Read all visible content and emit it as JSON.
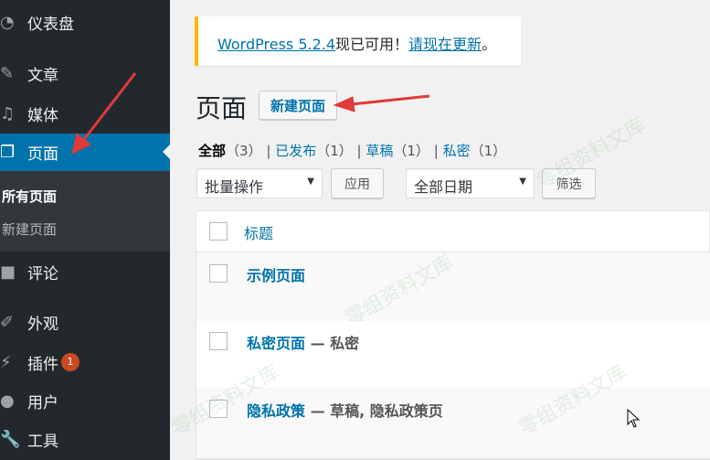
{
  "sidebar": {
    "items": [
      {
        "label": "仪表盘",
        "icon": "dashboard-icon"
      },
      {
        "label": "文章",
        "icon": "pin-icon"
      },
      {
        "label": "媒体",
        "icon": "media-icon"
      },
      {
        "label": "页面",
        "icon": "page-icon"
      },
      {
        "label": "评论",
        "icon": "comment-icon"
      },
      {
        "label": "外观",
        "icon": "brush-icon"
      },
      {
        "label": "插件",
        "icon": "plugin-icon",
        "badge": "1"
      },
      {
        "label": "用户",
        "icon": "user-icon"
      },
      {
        "label": "工具",
        "icon": "wrench-icon"
      }
    ],
    "submenu": [
      "所有页面",
      "新建页面"
    ]
  },
  "notice": {
    "link": "WordPress 5.2.4",
    "text": "现已可用！",
    "update_link": "请现在更新",
    "end": "。"
  },
  "page": {
    "title": "页面",
    "new_button": "新建页面"
  },
  "filters": {
    "all": "全部",
    "all_count": "（3）",
    "published": "已发布",
    "published_count": "（1）",
    "draft": "草稿",
    "draft_count": "（1）",
    "private": "私密",
    "private_count": "（1）",
    "sep": "|"
  },
  "actions": {
    "bulk": "批量操作",
    "apply": "应用",
    "dates": "全部日期",
    "filter": "筛选"
  },
  "table": {
    "header": "标题",
    "rows": [
      {
        "title": "示例页面",
        "state": ""
      },
      {
        "title": "私密页面",
        "state": " — 私密"
      },
      {
        "title": "隐私政策",
        "state": " — 草稿, 隐私政策页"
      }
    ]
  },
  "watermark": "零组资料文库",
  "colors": {
    "sidebar": "#23282d",
    "active": "#0073aa",
    "notice": "#ffb900",
    "badge": "#ca4a1f",
    "arrow": "#e03a3a"
  }
}
